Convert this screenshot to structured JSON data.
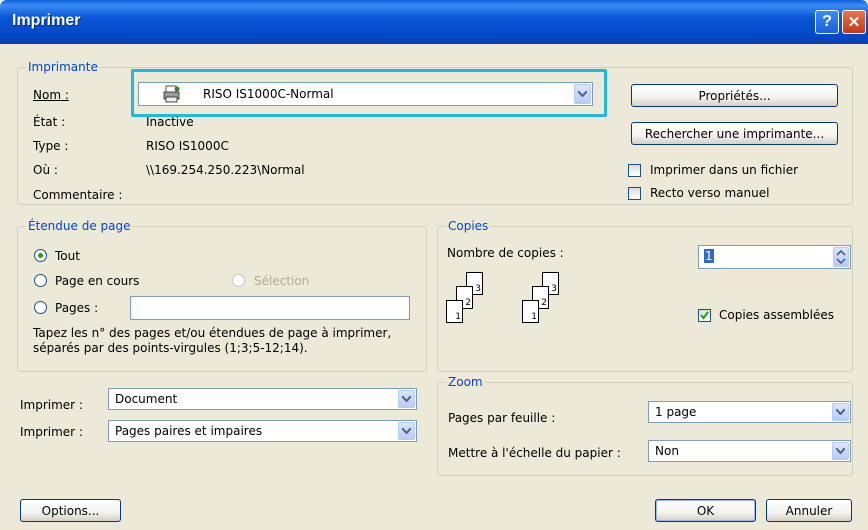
{
  "window": {
    "title": "Imprimer"
  },
  "printer": {
    "legend": "Imprimante",
    "name_label": "Nom :",
    "name_value": "RISO IS1000C-Normal",
    "status_label": "État :",
    "status_value": "Inactive",
    "type_label": "Type :",
    "type_value": "RISO IS1000C",
    "where_label": "Où :",
    "where_value": "\\\\169.254.250.223\\Normal",
    "comment_label": "Commentaire :",
    "properties_button": "Propriétés...",
    "find_button": "Rechercher une imprimante...",
    "print_to_file": "Imprimer dans un fichier",
    "print_to_file_checked": false,
    "manual_duplex": "Recto verso manuel",
    "manual_duplex_checked": false
  },
  "page_range": {
    "legend": "Étendue de page",
    "all": "Tout",
    "current": "Page en cours",
    "selection": "Sélection",
    "pages": "Pages :",
    "pages_value": "",
    "selected": "all",
    "hint": "Tapez les n° des pages et/ou étendues de page à imprimer, séparés par des points-virgules (1;3;5-12;14)."
  },
  "copies": {
    "legend": "Copies",
    "count_label": "Nombre de copies :",
    "count_value": "1",
    "collate_label": "Copies assemblées",
    "collate_checked": true,
    "page_numbers": [
      "3",
      "2",
      "1"
    ]
  },
  "print_what": {
    "label": "Imprimer :",
    "value": "Document"
  },
  "print_pages": {
    "label": "Imprimer :",
    "value": "Pages paires et impaires"
  },
  "zoom": {
    "legend": "Zoom",
    "pages_per_sheet_label": "Pages par feuille :",
    "pages_per_sheet_value": "1 page",
    "scale_label": "Mettre à l'échelle du papier :",
    "scale_value": "Non"
  },
  "buttons": {
    "options": "Options...",
    "ok": "OK",
    "cancel": "Annuler"
  },
  "colors": {
    "title_bar": "#0a55d6",
    "legend_text": "#0046d5",
    "highlight_box": "#1fb8de",
    "dialog_bg": "#ece9d8"
  }
}
